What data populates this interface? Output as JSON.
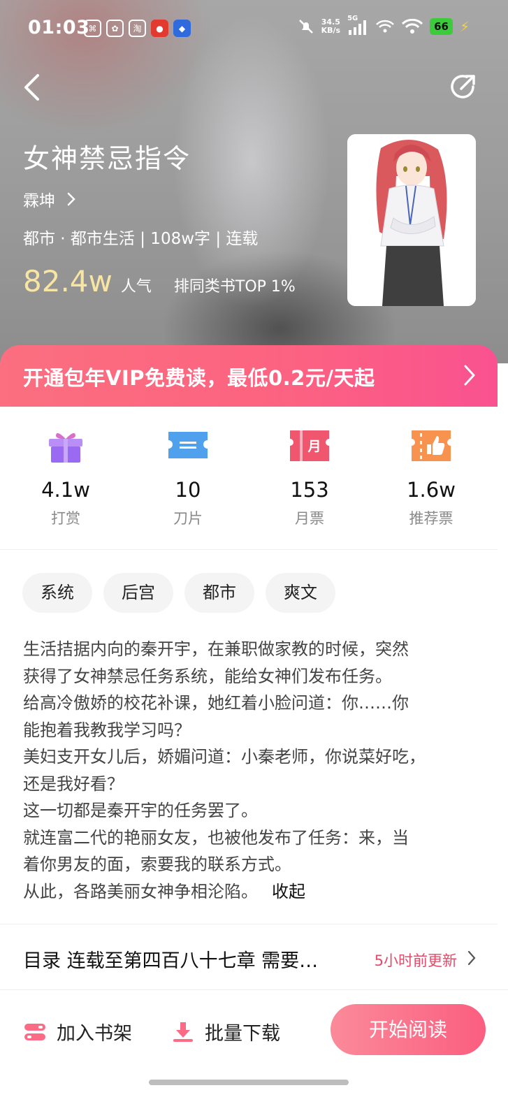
{
  "status_bar": {
    "time": "01:03",
    "app_icons": [
      "qr-scanner-icon",
      "photo-app-icon",
      "taobao-icon",
      "red-app-icon",
      "blue-app-icon"
    ],
    "app_icon_text": {
      "taobao": "淘"
    },
    "net_speed_value": "34.5",
    "net_speed_unit": "KB/s",
    "network": "5G",
    "battery": "66"
  },
  "book": {
    "title": "女神禁忌指令",
    "author": "霖坤",
    "meta": "都市 · 都市生活 | 108w字 | 连载",
    "popularity": "82.4w",
    "popularity_label": "人气",
    "rank": "排同类书TOP 1%"
  },
  "vip_banner": {
    "text": "开通包年VIP免费读，最低0.2元/天起"
  },
  "stats": [
    {
      "value": "4.1w",
      "label": "打赏",
      "icon": "gift-icon"
    },
    {
      "value": "10",
      "label": "刀片",
      "icon": "ticket-icon"
    },
    {
      "value": "153",
      "label": "月票",
      "icon": "monthly-ticket-icon",
      "icon_text": "月"
    },
    {
      "value": "1.6w",
      "label": "推荐票",
      "icon": "thumbs-up-ticket-icon"
    }
  ],
  "tags": [
    "系统",
    "后宫",
    "都市",
    "爽文"
  ],
  "intro": {
    "lines": [
      "生活拮据内向的秦开宇，在兼职做家教的时候，突然",
      "获得了女神禁忌任务系统，能给女神们发布任务。",
      "给高冷傲娇的校花补课，她红着小脸问道：你……你",
      "能抱着我教我学习吗？",
      "美妇支开女儿后，娇媚问道：小秦老师，你说菜好吃，",
      "还是我好看？",
      "这一切都是秦开宇的任务罢了。",
      "就连富二代的艳丽女友，也被他发布了任务：来，当",
      "着你男友的面，索要我的联系方式。",
      "从此，各路美丽女神争相沦陷。"
    ],
    "collapse_label": "收起"
  },
  "toc": {
    "text": "目录 连载至第四百八十七章 需要…",
    "update": "5小时前更新"
  },
  "bottom_bar": {
    "add_shelf": "加入书架",
    "batch_download": "批量下载",
    "start_reading": "开始阅读"
  },
  "colors": {
    "accent_pink": "#fb5e80",
    "popularity_gold": "#f7e6a3",
    "update_red": "#e44a69"
  }
}
